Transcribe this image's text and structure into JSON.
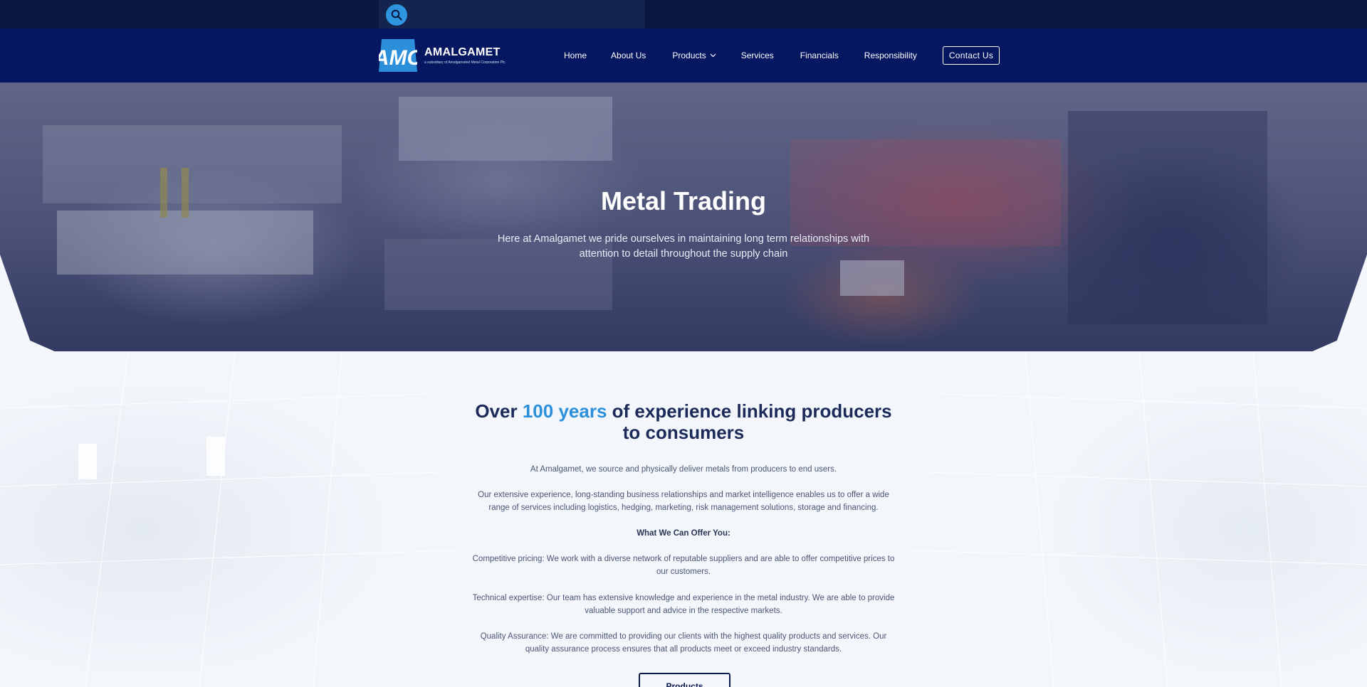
{
  "topbar": {
    "search_icon": "search-icon"
  },
  "brand": {
    "mark": "AMC",
    "name": "AMALGAMET",
    "tagline": "a subsidiary of Amalgamated Metal Corporation Plc"
  },
  "nav": {
    "items": [
      {
        "label": "Home"
      },
      {
        "label": "About Us"
      },
      {
        "label": "Products"
      },
      {
        "label": "Services"
      },
      {
        "label": "Financials"
      },
      {
        "label": "Responsibility"
      }
    ],
    "contact_label": "Contact Us"
  },
  "hero": {
    "title": "Metal Trading",
    "subtitle": "Here at Amalgamet we pride ourselves in maintaining long term relationships with attention to detail throughout the supply chain"
  },
  "intro": {
    "headline_pre": "Over ",
    "headline_accent": "100 years",
    "headline_post": " of experience linking producers to consumers",
    "p1": "At Amalgamet, we source and physically deliver metals from producers to end users.",
    "p2": "Our extensive experience, long-standing business relationships and market intelligence enables us to offer a wide range of services including logistics, hedging, marketing, risk management solutions, storage and financing.",
    "p3": "What We Can Offer You:",
    "p4": "Competitive pricing: We work with a diverse network of reputable suppliers and are able to offer competitive prices to our customers.",
    "p5": "Technical expertise: Our team has extensive knowledge and experience in the metal industry. We are able to provide valuable support and advice in the respective markets.",
    "p6": "Quality Assurance: We are committed to providing our clients with the highest quality products and services. Our quality assurance process ensures that all products meet or exceed industry standards.",
    "cta_label": "Products"
  },
  "colors": {
    "topbar": "#0a1740",
    "navbar": "#061762",
    "accent": "#2b8fdb",
    "search_button": "#2f95e0"
  }
}
